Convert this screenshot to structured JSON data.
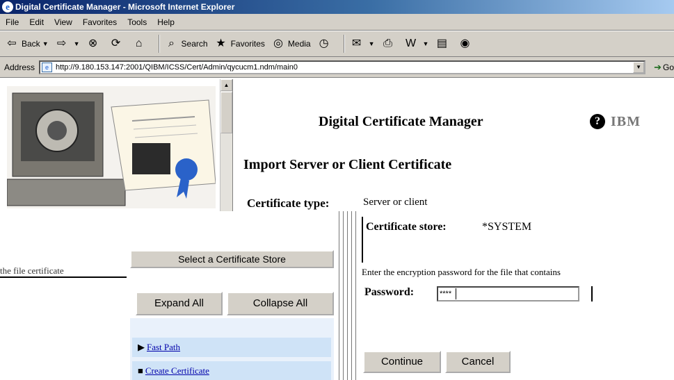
{
  "window": {
    "title": "Digital Certificate Manager - Microsoft Internet Explorer"
  },
  "menu": {
    "items": [
      "File",
      "Edit",
      "View",
      "Favorites",
      "Tools",
      "Help"
    ]
  },
  "toolbar": {
    "back_label": "Back",
    "search_label": "Search",
    "favorites_label": "Favorites",
    "media_label": "Media"
  },
  "address": {
    "label": "Address",
    "url": "http://9.180.153.147:2001/QIBM/ICSS/Cert/Admin/qycucm1.ndm/main0",
    "go_label": "Go"
  },
  "banner": {
    "title": "Digital Certificate Manager",
    "help": "?",
    "logo": "IBM"
  },
  "main": {
    "heading": "Import Server or Client Certificate",
    "cert_type_label": "Certificate type:",
    "cert_type_value": "Server or client",
    "store_label": "Certificate store:",
    "store_value": "*SYSTEM",
    "password_prompt": "Enter the encryption password for the file that contains",
    "password_label": "Password:",
    "password_value": "****",
    "continue_label": "Continue",
    "cancel_label": "Cancel"
  },
  "nav": {
    "select_store_label": "Select a Certificate Store",
    "expand_all_label": "Expand All",
    "collapse_all_label": "Collapse All",
    "items": [
      "Fast Path",
      "Create Certificate"
    ]
  },
  "fragment": {
    "file_text": "the file certificate"
  },
  "colors": {
    "titlebar": "#0a246a",
    "chrome": "#d4d0c8",
    "nav_item_bg": "#cfe3f7",
    "link": "#0000aa"
  }
}
